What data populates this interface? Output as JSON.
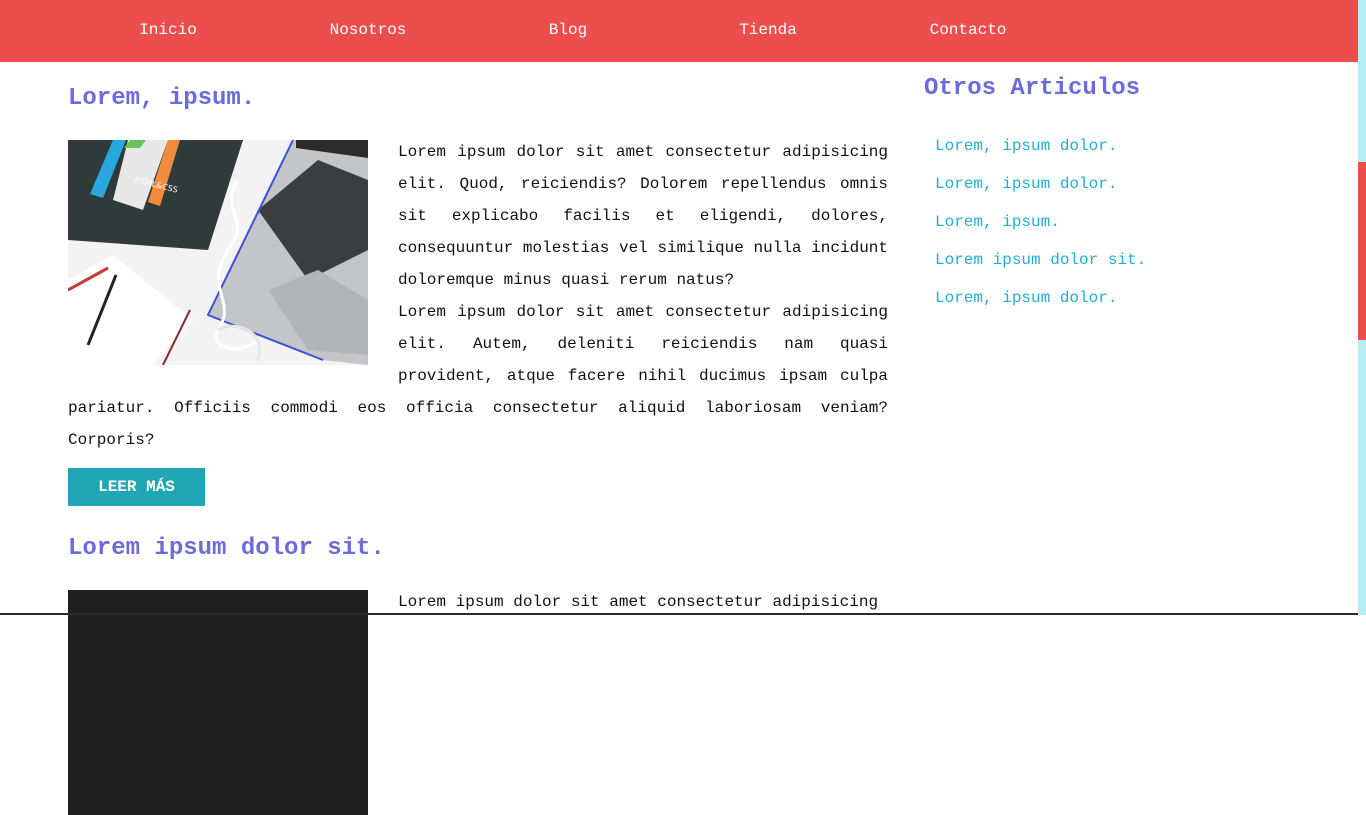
{
  "nav": {
    "items": [
      {
        "label": "Inicio"
      },
      {
        "label": "Nosotros"
      },
      {
        "label": "Blog"
      },
      {
        "label": "Tienda"
      },
      {
        "label": "Contacto"
      }
    ]
  },
  "articles": [
    {
      "title": "Lorem, ipsum.",
      "paragraphs": [
        "Lorem ipsum dolor sit amet consectetur adipisicing elit. Quod, reiciendis? Dolorem repellendus omnis sit explicabo facilis et eligendi, dolores, consequuntur molestias vel similique nulla incidunt doloremque minus quasi rerum natus?",
        "Lorem ipsum dolor sit amet consectetur adipisicing elit. Autem, deleniti reiciendis nam quasi provident, atque facere nihil ducimus ipsam culpa pariatur. Officiis commodi eos officia consectetur aliquid laboriosam veniam? Corporis?"
      ],
      "button_label": "LEER MÁS",
      "image_text": "HTML&CSS"
    },
    {
      "title": "Lorem ipsum dolor sit.",
      "paragraphs": [
        "Lorem ipsum dolor sit amet consectetur adipisicing"
      ]
    }
  ],
  "sidebar": {
    "title": "Otros Articulos",
    "links": [
      {
        "label": "Lorem, ipsum dolor."
      },
      {
        "label": "Lorem, ipsum dolor."
      },
      {
        "label": "Lorem, ipsum."
      },
      {
        "label": "Lorem ipsum dolor sit."
      },
      {
        "label": "Lorem, ipsum dolor."
      }
    ]
  },
  "colors": {
    "nav_background": "#ec4e4e",
    "heading": "#6c6bdc",
    "link": "#20afd0",
    "button": "#20a6b4",
    "scrollbar_track": "#b6ecf2",
    "scrollbar_thumb": "#ec4e4e"
  }
}
